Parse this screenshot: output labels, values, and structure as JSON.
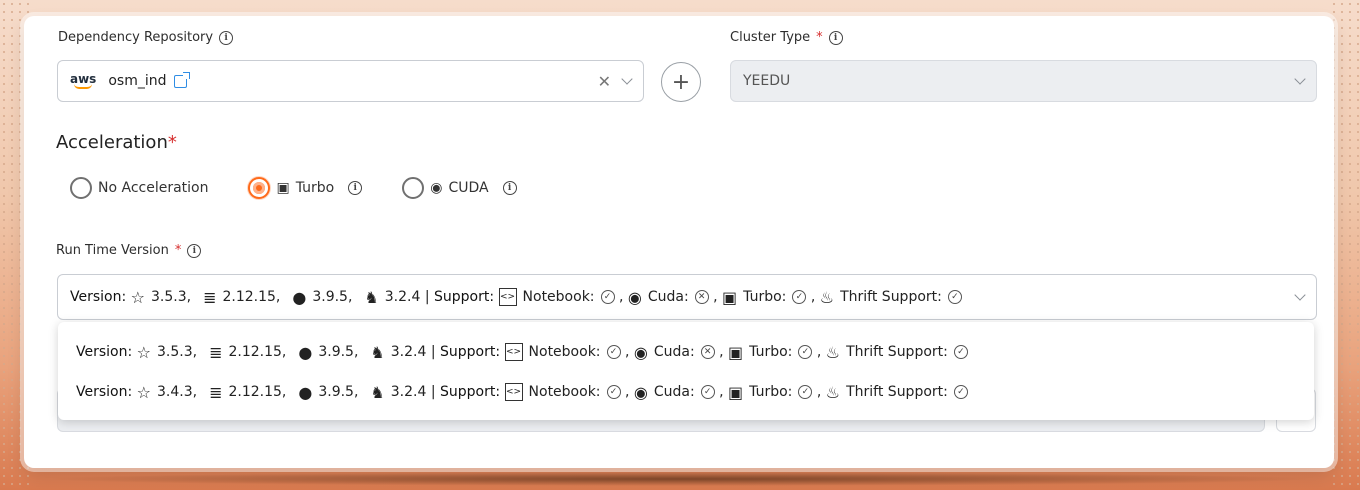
{
  "dependency_repo": {
    "label": "Dependency Repository",
    "logo_text": "aws",
    "value": "osm_ind"
  },
  "cluster_type": {
    "label": "Cluster Type",
    "required_mark": "*",
    "value": "YEEDU"
  },
  "acceleration": {
    "label": "Acceleration",
    "required_mark": "*",
    "options": [
      {
        "label": "No Acceleration",
        "selected": false
      },
      {
        "label": "Turbo",
        "selected": true
      },
      {
        "label": "CUDA",
        "selected": false
      }
    ],
    "accent_color": "#ff6a1a"
  },
  "runtime": {
    "label": "Run Time Version",
    "required_mark": "*",
    "selected": {
      "version_label": "Version:",
      "spark": "3.5.3",
      "scala": "2.12.15",
      "python": "3.9.5",
      "hadoop": "3.2.4",
      "support_label": "Support:",
      "notebook": "Notebook:",
      "cuda": "Cuda:",
      "turbo": "Turbo:",
      "thrift": "Thrift Support:"
    },
    "options": [
      {
        "version_label": "Version:",
        "spark": "3.5.3",
        "scala": "2.12.15",
        "python": "3.9.5",
        "hadoop": "3.2.4",
        "support_label": "Support:",
        "notebook": "Notebook:",
        "cuda": "Cuda:",
        "turbo": "Turbo:",
        "thrift": "Thrift Support:"
      },
      {
        "version_label": "Version:",
        "spark": "3.4.3",
        "scala": "2.12.15",
        "python": "3.9.5",
        "hadoop": "3.2.4",
        "support_label": "Support:",
        "notebook": "Notebook:",
        "cuda": "Cuda:",
        "turbo": "Turbo:",
        "thrift": "Thrift Support:"
      }
    ]
  }
}
